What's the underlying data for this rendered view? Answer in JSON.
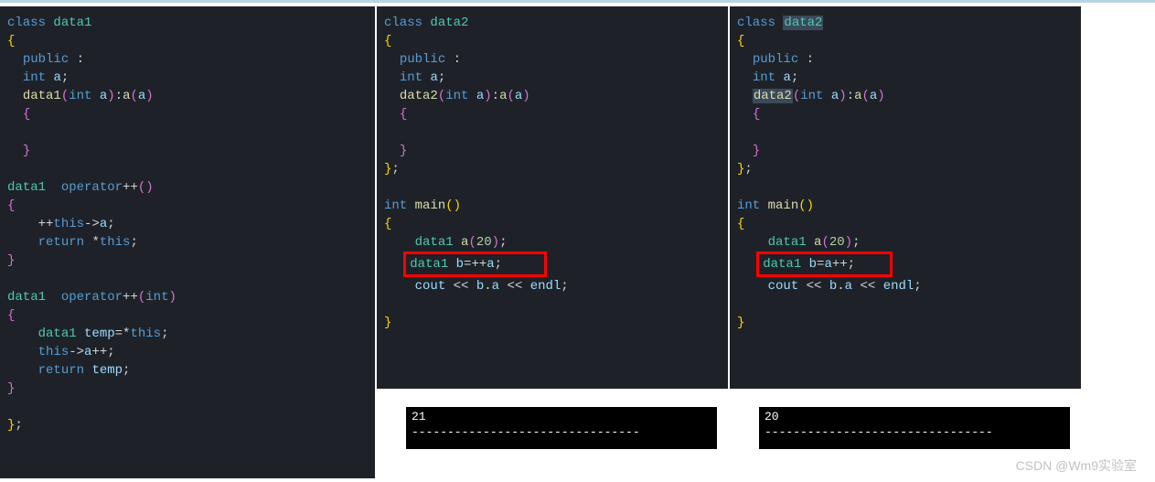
{
  "panel1": {
    "tokens": {
      "class": "class",
      "data1": "data1",
      "public": "public",
      "int": "int",
      "a": "a",
      "data1_ctor": "data1",
      "int_param": "int",
      "a_param": "a",
      "return": "return",
      "this": "this",
      "operator": "operator",
      "plusplus": "++",
      "temp": "temp",
      "star": "*"
    }
  },
  "panel2": {
    "tokens": {
      "class": "class",
      "data2": "data2",
      "public": "public",
      "int": "int",
      "a": "a",
      "data2_ctor": "data2",
      "main": "main",
      "data1": "data1",
      "a_var": "a",
      "twenty": "20",
      "b": "b",
      "plusplus_a": "++a",
      "cout": "cout",
      "b_a": "b.a",
      "endl": "endl"
    },
    "highlighted_line": "data1 b=++a;"
  },
  "panel3": {
    "tokens": {
      "class": "class",
      "data2": "data2",
      "public": "public",
      "int": "int",
      "a": "a",
      "data2_ctor": "data2",
      "main": "main",
      "data1": "data1",
      "a_var": "a",
      "twenty": "20",
      "b": "b",
      "a_plusplus": "a++",
      "cout": "cout",
      "b_a": "b.a",
      "endl": "endl"
    },
    "highlighted_line": "data1 b=a++;"
  },
  "console2": {
    "output": "21",
    "dashes": "--------------------------------"
  },
  "console3": {
    "output": "20",
    "dashes": "--------------------------------"
  },
  "watermark": "CSDN @Wm9实验室"
}
